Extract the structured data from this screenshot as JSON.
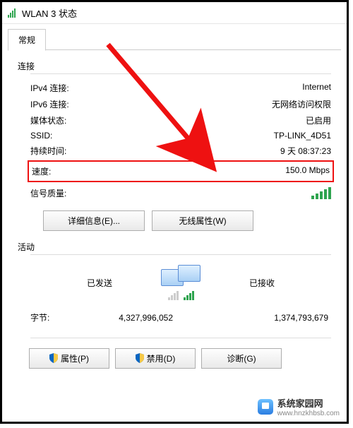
{
  "window": {
    "title": "WLAN 3 状态"
  },
  "tabs": {
    "general": "常规"
  },
  "conn": {
    "heading": "连接",
    "ipv4_lbl": "IPv4 连接:",
    "ipv4_val": "Internet",
    "ipv6_lbl": "IPv6 连接:",
    "ipv6_val": "无网络访问权限",
    "media_lbl": "媒体状态:",
    "media_val": "已启用",
    "ssid_lbl": "SSID:",
    "ssid_val": "TP-LINK_4D51",
    "dur_lbl": "持续时间:",
    "dur_val": "9 天 08:37:23",
    "speed_lbl": "速度:",
    "speed_val": "150.0 Mbps",
    "sig_lbl": "信号质量:"
  },
  "buttons": {
    "details": "详细信息(E)...",
    "wireless": "无线属性(W)",
    "props": "属性(P)",
    "disable": "禁用(D)",
    "diag": "诊断(G)"
  },
  "activity": {
    "heading": "活动",
    "sent": "已发送",
    "recv": "已接收",
    "bytes_lbl": "字节:",
    "bytes_sent": "4,327,996,052",
    "bytes_recv": "1,374,793,679"
  },
  "watermark": {
    "name": "系统家园网",
    "url": "www.hnzkhbsb.com"
  }
}
